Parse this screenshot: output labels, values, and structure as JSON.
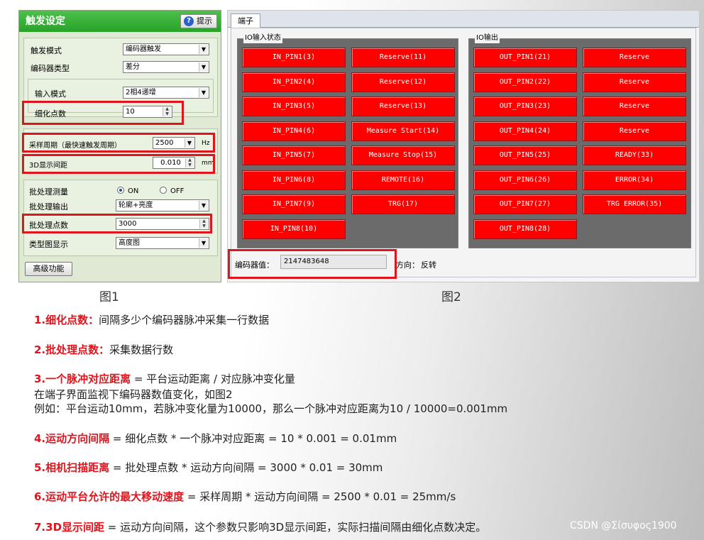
{
  "figure1": {
    "title": "触发设定",
    "help_button": "提示",
    "trigger_mode": {
      "label": "触发模式",
      "value": "编码器触发"
    },
    "encoder_type": {
      "label": "编码器类型",
      "value": "差分"
    },
    "input_mode": {
      "label": "输入模式",
      "value": "2相4递增"
    },
    "subdivision": {
      "label": "细化点数",
      "value": "10"
    },
    "sampling_period": {
      "label": "采样周期（最快速触发周期）",
      "value": "2500",
      "unit": "Hz"
    },
    "display_3d": {
      "label": "3D显示间距",
      "value": "0.010",
      "unit": "mm"
    },
    "batch_measure": {
      "label": "批处理测量",
      "on_label": "ON",
      "off_label": "OFF",
      "selected": "ON"
    },
    "batch_output": {
      "label": "批处理输出",
      "value": "轮廓+亮度"
    },
    "batch_points": {
      "label": "批处理点数",
      "value": "3000"
    },
    "type_display": {
      "label": "类型图显示",
      "value": "高度图"
    },
    "advanced_button": "高级功能",
    "caption": "图1"
  },
  "figure2": {
    "tab": "端子",
    "io_input": {
      "legend": "IO输入状态",
      "left": [
        "IN_PIN1(3)",
        "IN_PIN2(4)",
        "IN_PIN3(5)",
        "IN_PIN4(6)",
        "IN_PIN5(7)",
        "IN_PIN6(8)",
        "IN_PIN7(9)",
        "IN_PIN8(10)"
      ],
      "right": [
        "Reserve(11)",
        "Reserve(12)",
        "Reserve(13)",
        "Measure Start(14)",
        "Measure Stop(15)",
        "REMOTE(16)",
        "TRG(17)"
      ]
    },
    "io_output": {
      "legend": "IO输出",
      "left": [
        "OUT_PIN1(21)",
        "OUT_PIN2(22)",
        "OUT_PIN3(23)",
        "OUT_PIN4(24)",
        "OUT_PIN5(25)",
        "OUT_PIN6(26)",
        "OUT_PIN7(27)",
        "OUT_PIN8(28)"
      ],
      "right": [
        "Reserve",
        "Reserve",
        "Reserve",
        "Reserve",
        "READY(33)",
        "ERROR(34)",
        "TRG ERROR(35)"
      ]
    },
    "encoder_label": "编码器值：",
    "encoder_value": "2147483648",
    "direction_label": "方向：",
    "direction_value": "反转",
    "caption": "图2"
  },
  "notes": [
    {
      "head": "1.细化点数：",
      "body": "间隔多少个编码器脉冲采集一行数据"
    },
    {
      "head": "2.批处理点数：",
      "body": "采集数据行数"
    },
    {
      "head": "3.一个脉冲对应距离",
      "body": " = 平台运动距离 / 对应脉冲变化量"
    },
    {
      "head": "",
      "body": "在端子界面监视下编码器数值变化，如图2"
    },
    {
      "head": "",
      "body": "例如：平台运动10mm，若脉冲变化量为10000，那么一个脉冲对应距离为10 / 10000=0.001mm"
    },
    {
      "head": "4.运动方向间隔",
      "body": " = 细化点数 * 一个脉冲对应距离 = 10 * 0.001 = 0.01mm"
    },
    {
      "head": "5.相机扫描距离",
      "body": " = 批处理点数 * 运动方向间隔 = 3000 * 0.01 = 30mm"
    },
    {
      "head": "6.运动平台允许的最大移动速度",
      "body": " = 采样周期 * 运动方向间隔 = 2500 * 0.01 = 25mm/s"
    },
    {
      "head": "7.3D显示间距",
      "body": " = 运动方向间隔，这个参数只影响3D显示间距，实际扫描间隔由细化点数决定。"
    }
  ],
  "watermark": "CSDN @Σίσυφος1900",
  "colors": {
    "title_green": "#27a227",
    "pin_red": "#ff0000",
    "highlight_red": "#e0141c"
  }
}
